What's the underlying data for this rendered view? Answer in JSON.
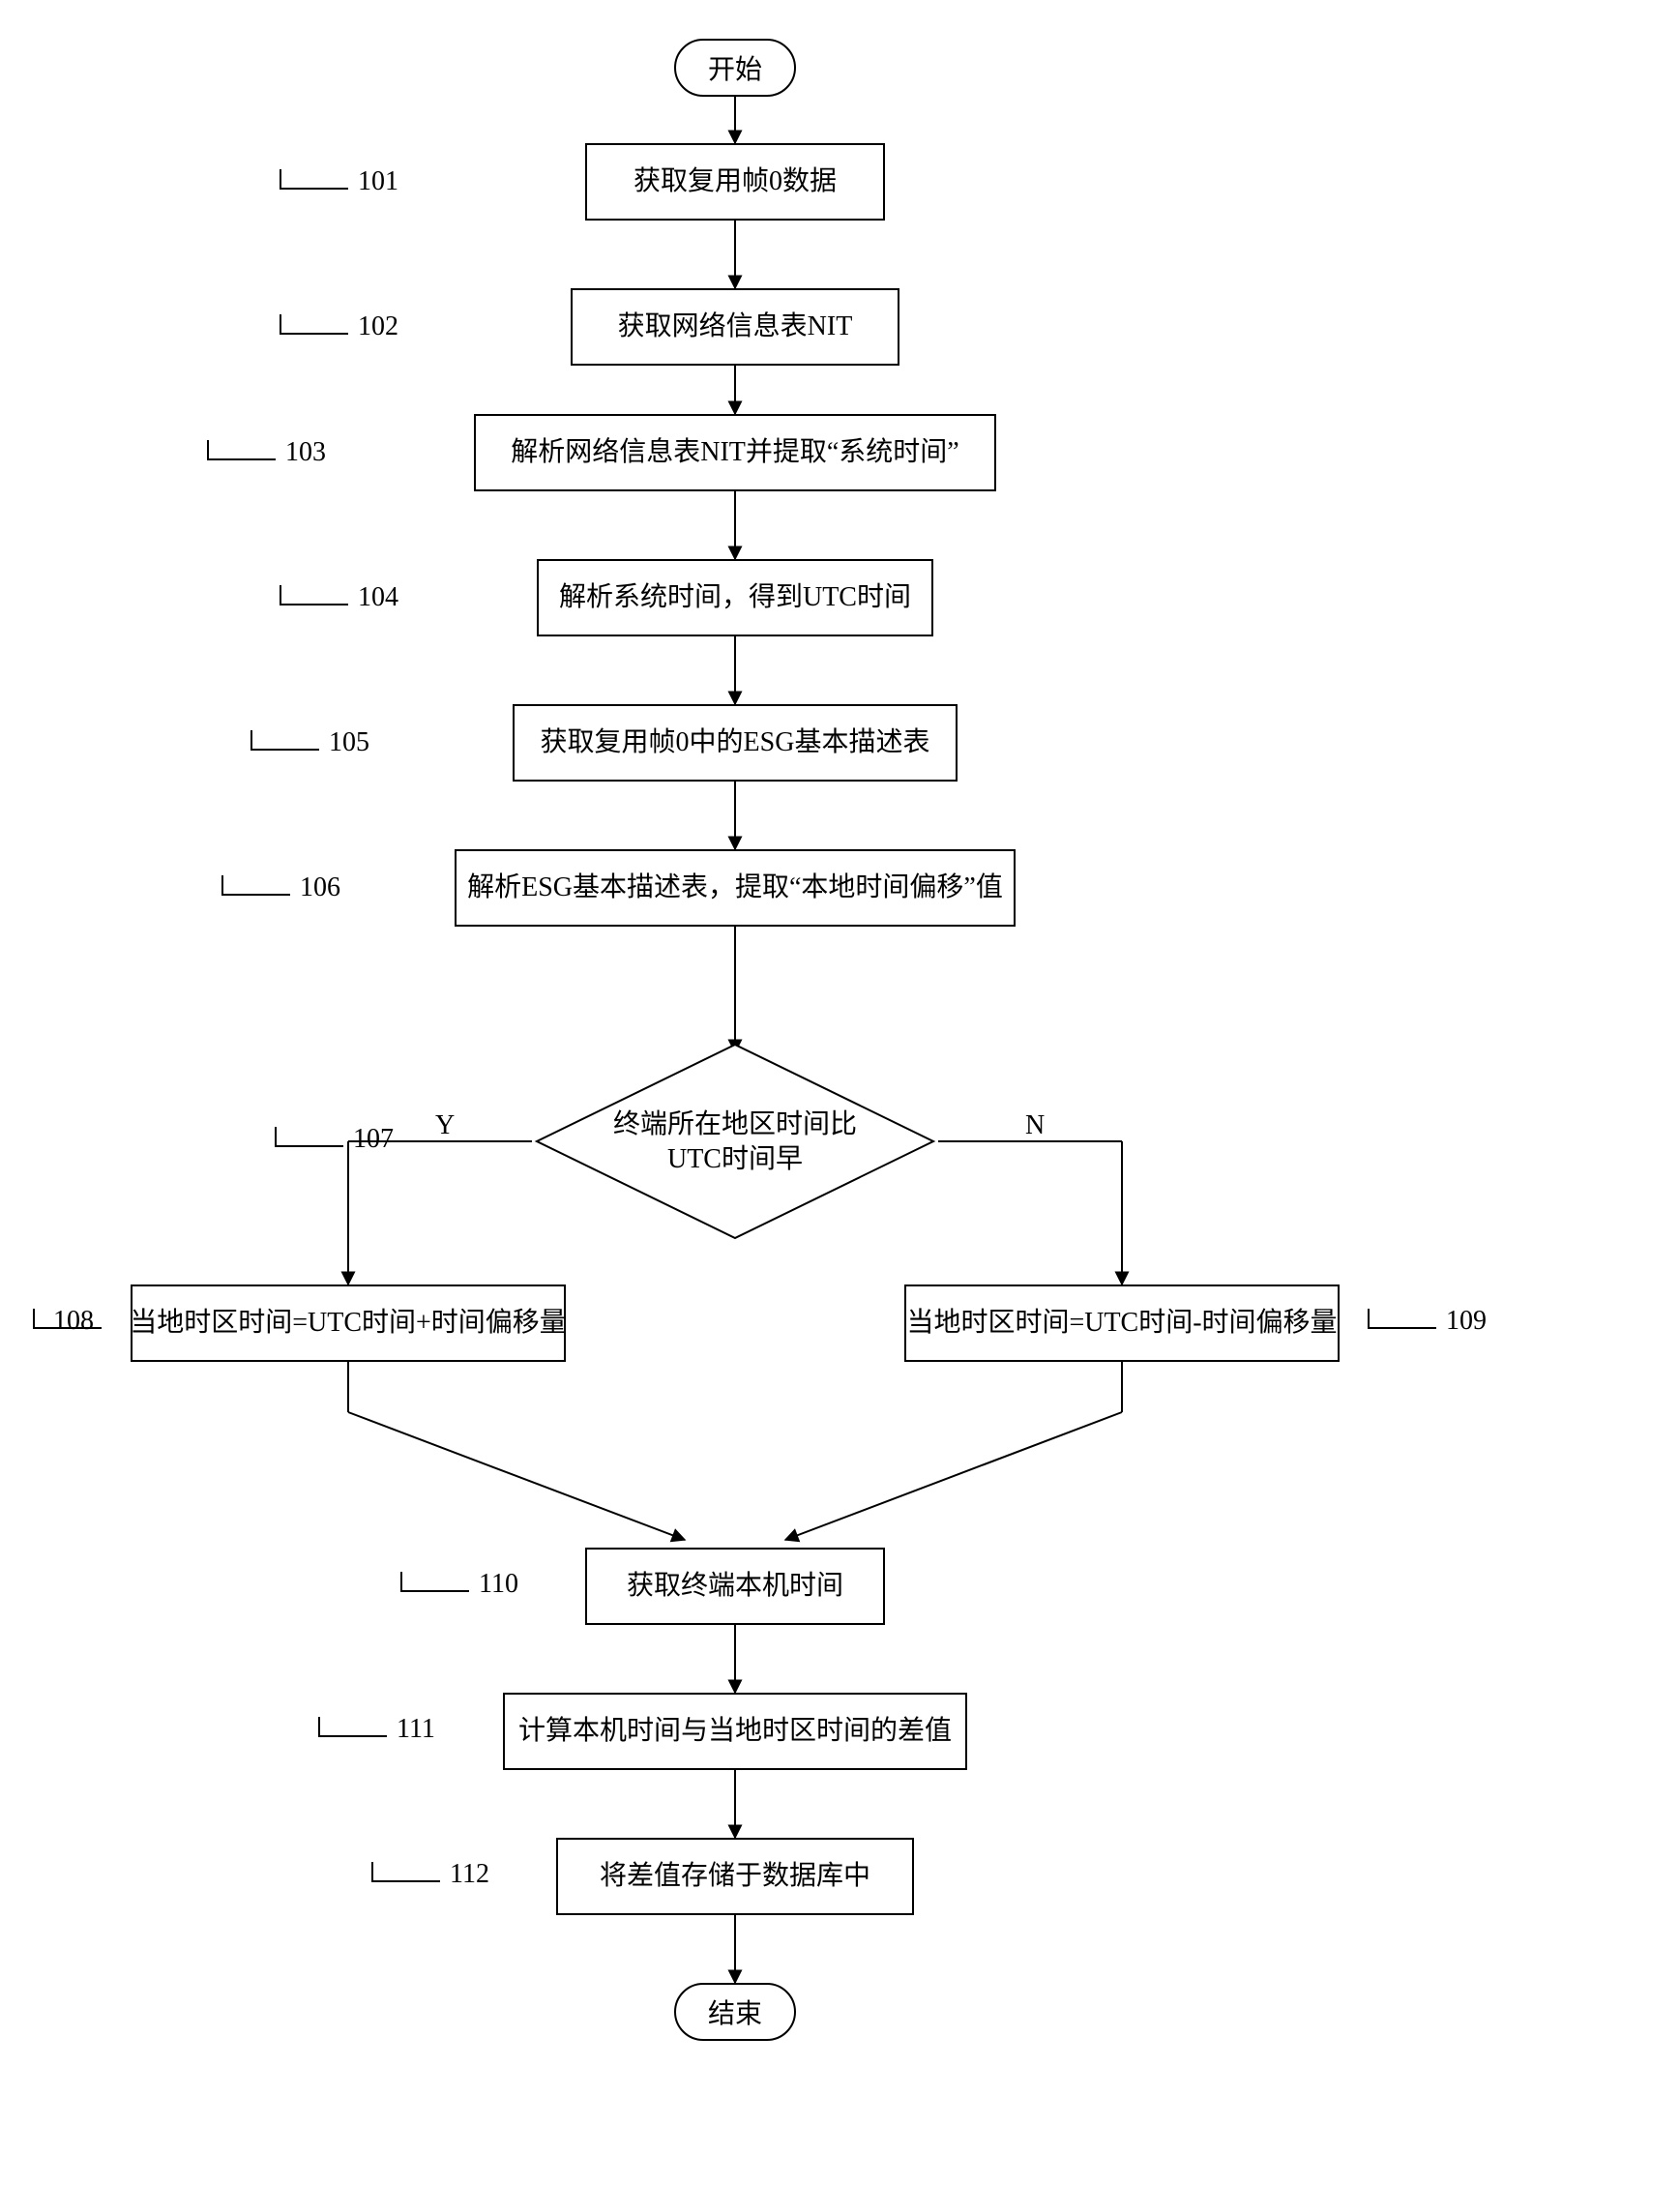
{
  "chart_data": {
    "type": "flowchart",
    "title": "",
    "direction": "top-down",
    "nodes": [
      {
        "id": "start",
        "kind": "terminator",
        "label": "开始"
      },
      {
        "id": "n101",
        "kind": "process",
        "label": "获取复用帧0数据",
        "step": "101"
      },
      {
        "id": "n102",
        "kind": "process",
        "label": "获取网络信息表NIT",
        "step": "102"
      },
      {
        "id": "n103",
        "kind": "process",
        "label": "解析网络信息表NIT并提取\"系统时间\"",
        "step": "103"
      },
      {
        "id": "n104",
        "kind": "process",
        "label": "解析系统时间，得到UTC时间",
        "step": "104"
      },
      {
        "id": "n105",
        "kind": "process",
        "label": "获取复用帧0中的ESG基本描述表",
        "step": "105"
      },
      {
        "id": "n106",
        "kind": "process",
        "label": "解析ESG基本描述表，提取\"本地时间偏移\"值",
        "step": "106"
      },
      {
        "id": "n107",
        "kind": "decision",
        "label": "终端所在地区时间比\nUTC时间早",
        "step": "107"
      },
      {
        "id": "n108",
        "kind": "process",
        "label": "当地时区时间=UTC时间+时间偏移量",
        "step": "108"
      },
      {
        "id": "n109",
        "kind": "process",
        "label": "当地时区时间=UTC时间-时间偏移量",
        "step": "109"
      },
      {
        "id": "n110",
        "kind": "process",
        "label": "获取终端本机时间",
        "step": "110"
      },
      {
        "id": "n111",
        "kind": "process",
        "label": "计算本机时间与当地时区时间的差值",
        "step": "111"
      },
      {
        "id": "n112",
        "kind": "process",
        "label": "将差值存储于数据库中",
        "step": "112"
      },
      {
        "id": "end",
        "kind": "terminator",
        "label": "结束"
      }
    ],
    "edges": [
      {
        "from": "start",
        "to": "n101",
        "label": ""
      },
      {
        "from": "n101",
        "to": "n102",
        "label": ""
      },
      {
        "from": "n102",
        "to": "n103",
        "label": ""
      },
      {
        "from": "n103",
        "to": "n104",
        "label": ""
      },
      {
        "from": "n104",
        "to": "n105",
        "label": ""
      },
      {
        "from": "n105",
        "to": "n106",
        "label": ""
      },
      {
        "from": "n106",
        "to": "n107",
        "label": ""
      },
      {
        "from": "n107",
        "to": "n108",
        "label": "Y"
      },
      {
        "from": "n107",
        "to": "n109",
        "label": "N"
      },
      {
        "from": "n108",
        "to": "n110",
        "label": ""
      },
      {
        "from": "n109",
        "to": "n110",
        "label": ""
      },
      {
        "from": "n110",
        "to": "n111",
        "label": ""
      },
      {
        "from": "n111",
        "to": "n112",
        "label": ""
      },
      {
        "from": "n112",
        "to": "end",
        "label": ""
      }
    ]
  },
  "labels": {
    "start": "开始",
    "end": "结束",
    "s101": "获取复用帧0数据",
    "s102": "获取网络信息表NIT",
    "s103": "解析网络信息表NIT并提取“系统时间”",
    "s104": "解析系统时间，得到UTC时间",
    "s105": "获取复用帧0中的ESG基本描述表",
    "s106": "解析ESG基本描述表，提取“本地时间偏移”值",
    "s107a": "终端所在地区时间比",
    "s107b": "UTC时间早",
    "s108": "当地时区时间=UTC时间+时间偏移量",
    "s109": "当地时区时间=UTC时间-时间偏移量",
    "s110": "获取终端本机时间",
    "s111": "计算本机时间与当地时区时间的差值",
    "s112": "将差值存储于数据库中",
    "y": "Y",
    "n": "N",
    "tag101": "101",
    "tag102": "102",
    "tag103": "103",
    "tag104": "104",
    "tag105": "105",
    "tag106": "106",
    "tag107": "107",
    "tag108": "108",
    "tag109": "109",
    "tag110": "110",
    "tag111": "111",
    "tag112": "112"
  }
}
